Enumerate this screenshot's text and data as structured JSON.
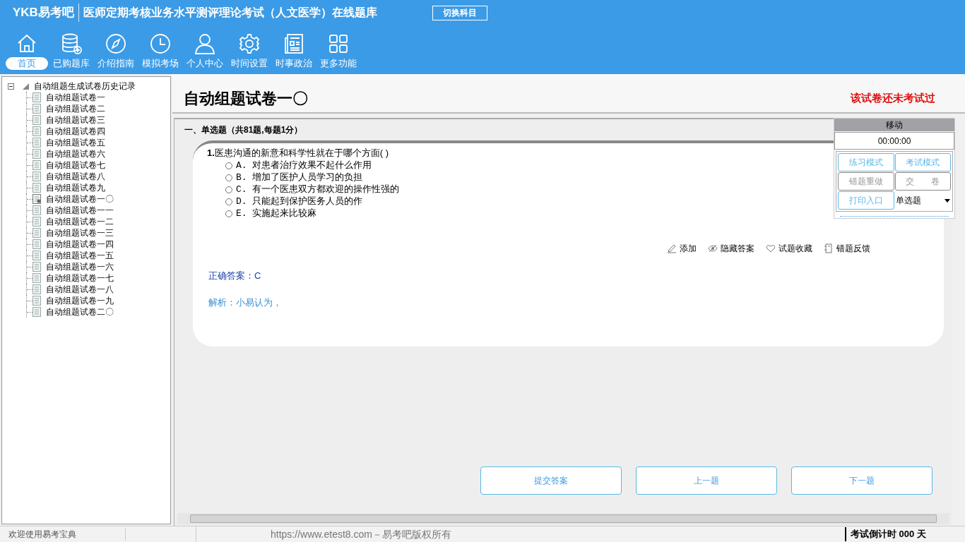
{
  "header": {
    "logo": "YKB易考吧",
    "title": "医师定期考核业务水平测评理论考试（人文医学）在线题库",
    "switch_button": "切换科目"
  },
  "toolbar": [
    {
      "label": "首页",
      "kind": "home",
      "selected": true
    },
    {
      "label": "已购题库",
      "kind": "database",
      "selected": false
    },
    {
      "label": "介绍指南",
      "kind": "compass",
      "selected": false
    },
    {
      "label": "模拟考场",
      "kind": "clock",
      "selected": false
    },
    {
      "label": "个人中心",
      "kind": "user",
      "selected": false
    },
    {
      "label": "时间设置",
      "kind": "gear",
      "selected": false
    },
    {
      "label": "时事政治",
      "kind": "news",
      "selected": false
    },
    {
      "label": "更多功能",
      "kind": "grid",
      "selected": false
    }
  ],
  "tree": {
    "label": "自动组题生成试卷历史记录",
    "expanded": true,
    "children": [
      {
        "label": "自动组题试卷一",
        "kind": "plain"
      },
      {
        "label": "自动组题试卷二",
        "kind": "plain"
      },
      {
        "label": "自动组题试卷三",
        "kind": "plain"
      },
      {
        "label": "自动组题试卷四",
        "kind": "plain"
      },
      {
        "label": "自动组题试卷五",
        "kind": "plain"
      },
      {
        "label": "自动组题试卷六",
        "kind": "plain"
      },
      {
        "label": "自动组题试卷七",
        "kind": "plain"
      },
      {
        "label": "自动组题试卷八",
        "kind": "plain"
      },
      {
        "label": "自动组题试卷九",
        "kind": "plain"
      },
      {
        "label": "自动组题试卷一〇",
        "kind": "current"
      },
      {
        "label": "自动组题试卷一一",
        "kind": "plain"
      },
      {
        "label": "自动组题试卷一二",
        "kind": "plain"
      },
      {
        "label": "自动组题试卷一三",
        "kind": "plain"
      },
      {
        "label": "自动组题试卷一四",
        "kind": "plain"
      },
      {
        "label": "自动组题试卷一五",
        "kind": "plain"
      },
      {
        "label": "自动组题试卷一六",
        "kind": "plain"
      },
      {
        "label": "自动组题试卷一七",
        "kind": "plain"
      },
      {
        "label": "自动组题试卷一八",
        "kind": "plain"
      },
      {
        "label": "自动组题试卷一九",
        "kind": "plain"
      },
      {
        "label": "自动组题试卷二〇",
        "kind": "plain"
      }
    ]
  },
  "paper": {
    "title": "自动组题试卷一〇",
    "status": "该试卷还未考试过",
    "section": "一、单选题（共81题,每题1分）"
  },
  "question": {
    "number": "1.",
    "text": "医患沟通的新意和科学性就在于哪个方面( )",
    "options": [
      {
        "label": "A. 对患者治疗效果不起什么作用",
        "selected": false
      },
      {
        "label": "B. 增加了医护人员学习的负担",
        "selected": false
      },
      {
        "label": "C. 有一个医患双方都欢迎的操作性强的",
        "selected": false
      },
      {
        "label": "D. 只能起到保护医务人员的作",
        "selected": false
      },
      {
        "label": "E. 实施起来比较麻",
        "selected": false
      }
    ],
    "actions": [
      {
        "label": "添加",
        "kind": "pencil"
      },
      {
        "label": "隐藏答案",
        "kind": "eye"
      },
      {
        "label": "试题收藏",
        "kind": "heart"
      },
      {
        "label": "错题反馈",
        "kind": "book"
      }
    ],
    "answer": "正确答案：C",
    "analysis": "解析：小易认为，"
  },
  "widget": {
    "handle": "移动",
    "timer": "00:00:00",
    "buttons": [
      {
        "label": "练习模式",
        "disabled": false
      },
      {
        "label": "考试模式",
        "disabled": false
      },
      {
        "label": "错题重做",
        "disabled": true
      },
      {
        "label": "交　　卷",
        "disabled": true
      },
      {
        "label": "打印入口",
        "disabled": false
      }
    ],
    "type_select": "单选题"
  },
  "nav_buttons": [
    "提交答案",
    "上一题",
    "下一题"
  ],
  "status_bar": {
    "welcome": "欢迎使用易考宝典",
    "copyright": "https://www.etest8.com－易考吧版权所有",
    "countdown": "考试倒计时 000 天"
  }
}
